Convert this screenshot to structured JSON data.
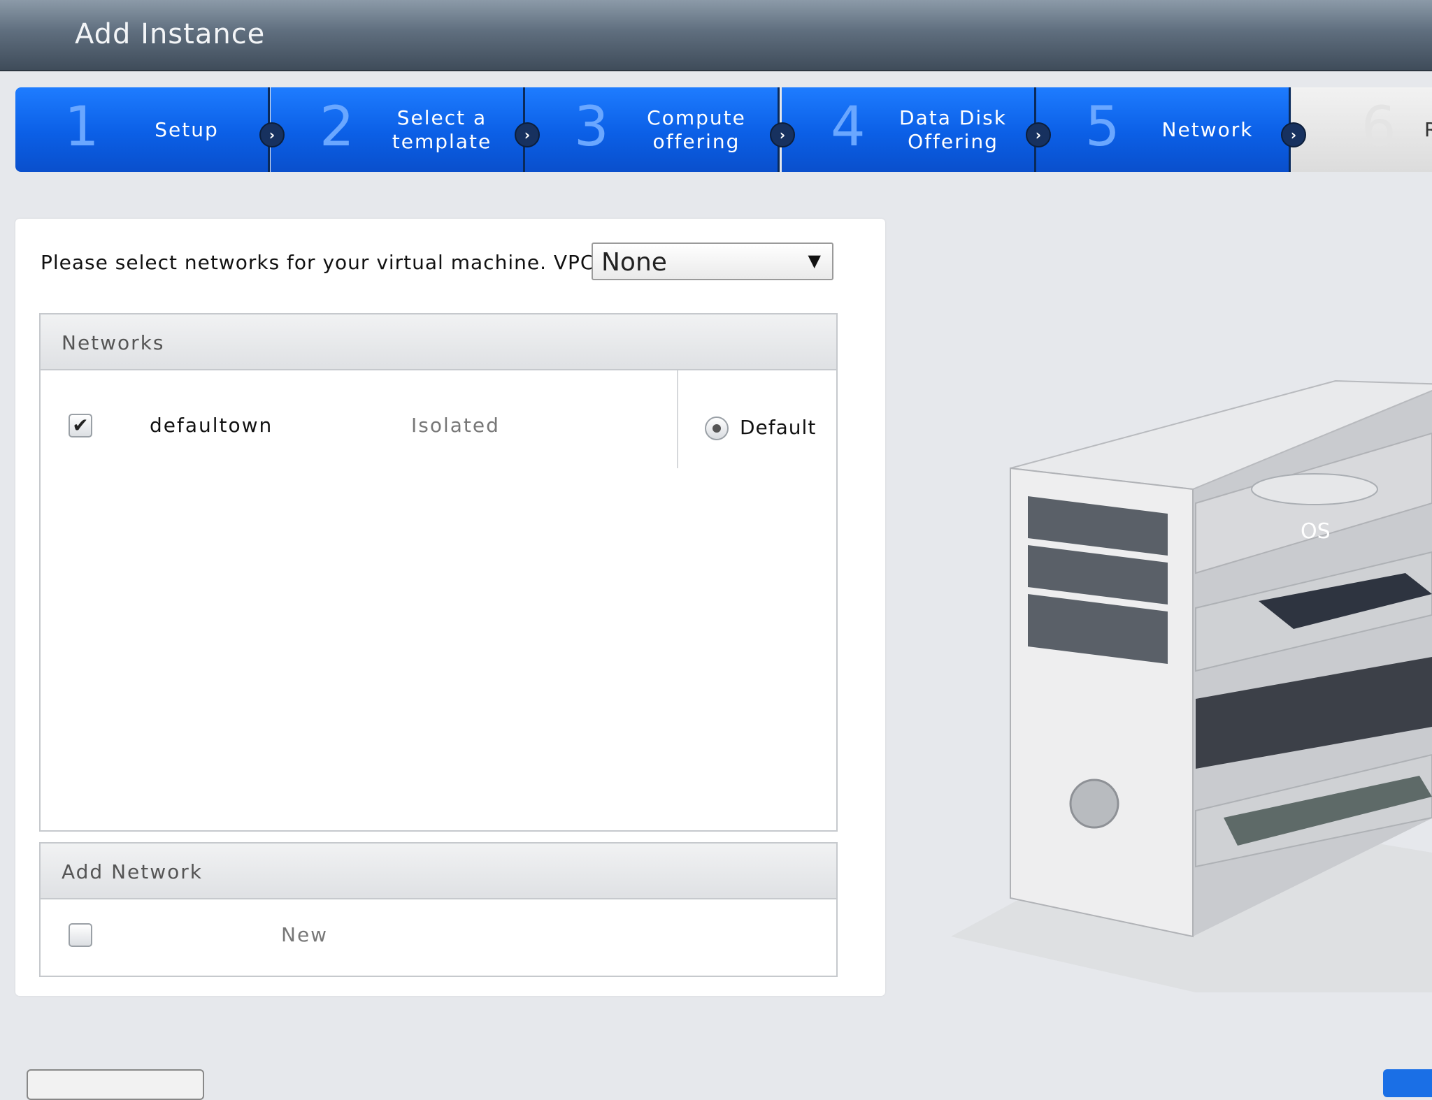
{
  "window": {
    "title": "Add Instance"
  },
  "wizard": {
    "steps": [
      {
        "number": "1",
        "label": "Setup",
        "state": "completed"
      },
      {
        "number": "2",
        "label": "Select a\ntemplate",
        "state": "completed"
      },
      {
        "number": "3",
        "label": "Compute\noffering",
        "state": "completed"
      },
      {
        "number": "4",
        "label": "Data Disk\nOffering",
        "state": "completed"
      },
      {
        "number": "5",
        "label": "Network",
        "state": "active"
      },
      {
        "number": "6",
        "label": "Re",
        "state": "inactive"
      }
    ]
  },
  "network_panel": {
    "prompt": "Please select networks for your virtual machine. VPC:",
    "vpc_select": {
      "value": "None"
    },
    "networks_section": {
      "title": "Networks",
      "rows": [
        {
          "checked": true,
          "name": "defaultown",
          "type": "Isolated",
          "default_label": "Default",
          "default_selected": true
        }
      ]
    },
    "add_network_section": {
      "title": "Add Network",
      "row": {
        "checked": false,
        "label": "New"
      }
    }
  },
  "illustration": {
    "os_label": "OS"
  },
  "colors": {
    "step_active": "#0b5fe6",
    "step_inactive": "#dcdcdc",
    "titlebar": "#5f6e7e"
  },
  "icons": {
    "step_arrow": "chevron-right-icon",
    "select_arrow": "caret-down-icon",
    "checkbox_checked": "checkmark-icon"
  }
}
